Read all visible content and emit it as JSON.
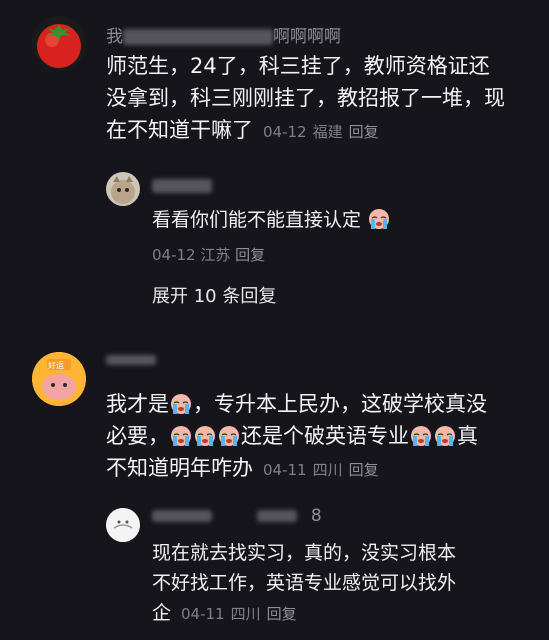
{
  "comment1": {
    "username_visible": "我",
    "username_tail": "啊啊啊啊",
    "text_line1": "师范生，24了，科三挂了，教师资格证还",
    "text_line2": "没拿到，科三刚刚挂了，教招报了一堆，现",
    "text_line3": "在不知道干嘛了",
    "date": "04-12",
    "location": "福建",
    "reply_label": "回复",
    "reply": {
      "text": "看看你们能不能直接认定",
      "date": "04-12",
      "location": "江苏",
      "reply_label": "回复"
    },
    "expand_label": "展开 10 条回复"
  },
  "comment2": {
    "avatar_badge": "好运",
    "text_part1": "我才是",
    "text_part2": "，专升本上民办，这破学校真没",
    "text_part3": "必要，",
    "text_part4": "还是个破英语专业",
    "text_part5": "真",
    "text_line3": "不知道明年咋办",
    "date": "04-11",
    "location": "四川",
    "reply_label": "回复",
    "reply": {
      "username_tail": "8",
      "text_line1": "现在就去找实习，真的，没实习根本",
      "text_line2": "不好找工作，英语专业感觉可以找外",
      "text_line3": "企",
      "date": "04-11",
      "location": "四川",
      "reply_label": "回复"
    }
  },
  "icons": {
    "crying_emoji": "crying-face-icon"
  }
}
